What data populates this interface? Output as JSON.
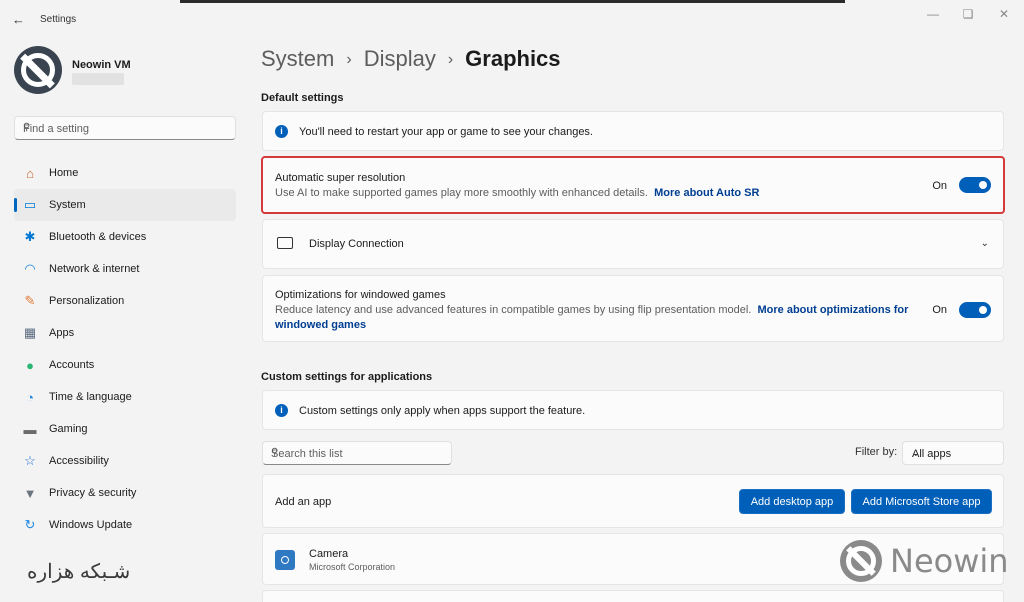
{
  "window": {
    "title": "Settings",
    "back_glyph": "←",
    "minimize": "—",
    "maximize": "❏",
    "close": "✕"
  },
  "user": {
    "name": "Neowin VM"
  },
  "search": {
    "placeholder": "Find a setting",
    "icon": "search-icon"
  },
  "sidebar": {
    "items": [
      {
        "label": "Home",
        "icon": "home-icon",
        "glyph": "⌂",
        "color": "#c8642a",
        "active": false
      },
      {
        "label": "System",
        "icon": "monitor-icon",
        "glyph": "▭",
        "color": "#0078d4",
        "active": true
      },
      {
        "label": "Bluetooth & devices",
        "icon": "bluetooth-icon",
        "glyph": "✱",
        "color": "#0078d4",
        "active": false
      },
      {
        "label": "Network & internet",
        "icon": "wifi-icon",
        "glyph": "◠",
        "color": "#1e88e5",
        "active": false
      },
      {
        "label": "Personalization",
        "icon": "brush-icon",
        "glyph": "✎",
        "color": "#e07b39",
        "active": false
      },
      {
        "label": "Apps",
        "icon": "apps-icon",
        "glyph": "▦",
        "color": "#5a6b80",
        "active": false
      },
      {
        "label": "Accounts",
        "icon": "person-icon",
        "glyph": "●",
        "color": "#2bb673",
        "active": false
      },
      {
        "label": "Time & language",
        "icon": "globe-clock-icon",
        "glyph": "◔",
        "color": "#1e88e5",
        "active": false
      },
      {
        "label": "Gaming",
        "icon": "gamepad-icon",
        "glyph": "▬",
        "color": "#6b6b6b",
        "active": false
      },
      {
        "label": "Accessibility",
        "icon": "accessibility-icon",
        "glyph": "☆",
        "color": "#1f6fd1",
        "active": false
      },
      {
        "label": "Privacy & security",
        "icon": "shield-icon",
        "glyph": "▼",
        "color": "#6b7580",
        "active": false
      },
      {
        "label": "Windows Update",
        "icon": "update-icon",
        "glyph": "↻",
        "color": "#1e88e5",
        "active": false
      }
    ]
  },
  "breadcrumb": {
    "items": [
      "System",
      "Display",
      "Graphics"
    ],
    "separator": "›"
  },
  "default_settings": {
    "title": "Default settings",
    "info": "You'll need to restart your app or game to see your changes.",
    "auto_sr": {
      "title": "Automatic super resolution",
      "desc": "Use AI to make supported games play more smoothly with enhanced details.",
      "link": "More about Auto SR",
      "state": "On",
      "highlight_color": "#d53a3a"
    },
    "display_connection": {
      "title": "Display Connection",
      "icon": "display-connection-icon"
    },
    "windowed": {
      "title": "Optimizations for windowed games",
      "desc": "Reduce latency and use advanced features in compatible games by using flip presentation model.",
      "link": "More about optimizations for windowed games",
      "state": "On"
    }
  },
  "custom_settings": {
    "title": "Custom settings for applications",
    "info": "Custom settings only apply when apps support the feature.",
    "list_search_placeholder": "Search this list",
    "filter_label": "Filter by:",
    "filter_value": "All apps",
    "add_app_label": "Add an app",
    "add_desktop_btn": "Add desktop app",
    "add_store_btn": "Add Microsoft Store app",
    "apps": [
      {
        "name": "Camera",
        "publisher": "Microsoft Corporation"
      }
    ]
  },
  "watermarks": {
    "arabic": "شـبکه هزاره",
    "neowin": "Neowin"
  },
  "accent_color": "#005fb8"
}
